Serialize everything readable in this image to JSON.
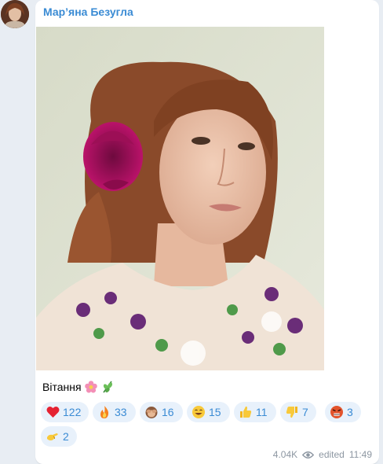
{
  "message": {
    "sender_name": "Мар’яна Безугла",
    "caption_text": "Вітання",
    "caption_emojis": [
      "flower-emoji",
      "herb-emoji"
    ],
    "photo_description_icon": "portrait-photo",
    "views": "4.04K",
    "edited_label": "edited",
    "time": "11:49"
  },
  "reactions": [
    {
      "icon": "red-heart-emoji",
      "count": "122"
    },
    {
      "icon": "fire-emoji",
      "count": "33"
    },
    {
      "icon": "see-no-evil-monkey-emoji",
      "count": "16"
    },
    {
      "icon": "grinning-face-emoji",
      "count": "15"
    },
    {
      "icon": "thumbs-up-emoji",
      "count": "11"
    },
    {
      "icon": "thumbs-down-emoji",
      "count": "7"
    },
    {
      "icon": "angry-face-emoji",
      "count": "3"
    },
    {
      "icon": "pinching-hand-emoji",
      "count": "2"
    }
  ],
  "colors": {
    "accent": "#3a8bd4",
    "reaction_bg": "#e8f1fb",
    "chat_bg": "#e8edf3",
    "meta_text": "#8d97a2"
  }
}
